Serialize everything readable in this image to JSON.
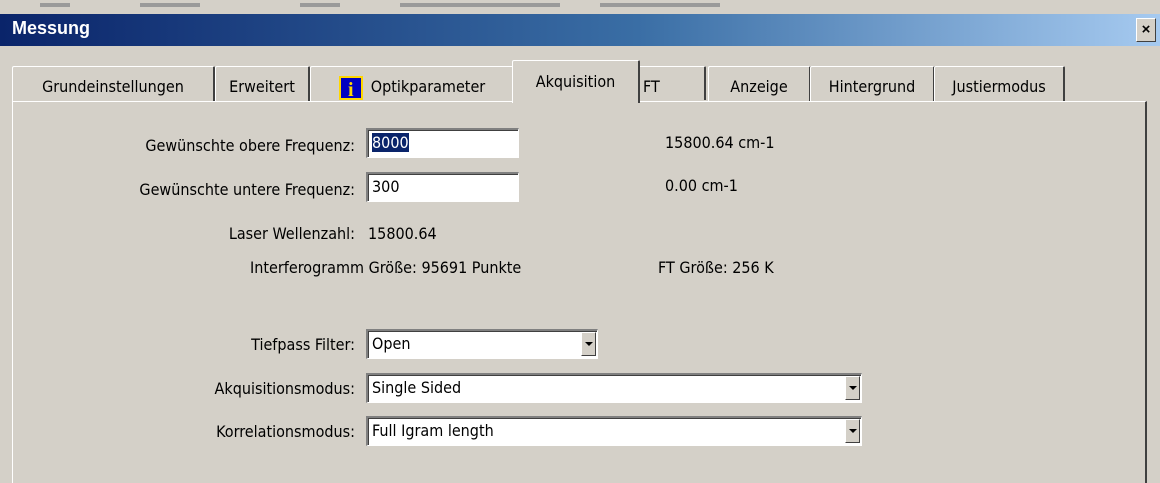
{
  "window": {
    "title": "Messung",
    "close_label": "×"
  },
  "tabs": [
    {
      "label": "Grundeinstellungen"
    },
    {
      "label": "Erweitert"
    },
    {
      "label": "Optikparameter",
      "icon": "info-icon"
    },
    {
      "label": "Akquisition",
      "active": true
    },
    {
      "label": "FT"
    },
    {
      "label": "Anzeige"
    },
    {
      "label": "Hintergrund"
    },
    {
      "label": "Justiermodus"
    }
  ],
  "info_icon_glyph": "i",
  "acquisition": {
    "upper_freq_label": "Gewünschte obere Frequenz:",
    "upper_freq_value": "8000",
    "upper_freq_result": "15800.64 cm-1",
    "lower_freq_label": "Gewünschte untere Frequenz:",
    "lower_freq_value": "300",
    "lower_freq_result": "0.00 cm-1",
    "laser_label": "Laser Wellenzahl:",
    "laser_value": "15800.64",
    "interferogram_text": "Interferogramm Größe: 95691 Punkte",
    "ft_size_text": "FT Größe: 256 K",
    "lowpass_label": "Tiefpass Filter:",
    "lowpass_value": "Open",
    "acq_mode_label": "Akquisitionsmodus:",
    "acq_mode_value": "Single Sided",
    "corr_mode_label": "Korrelationsmodus:",
    "corr_mode_value": "Full Igram length"
  },
  "colors": {
    "face": "#d4d0c8",
    "title_start": "#0a246a",
    "title_end": "#a6caf0",
    "selection": "#0a246a"
  }
}
